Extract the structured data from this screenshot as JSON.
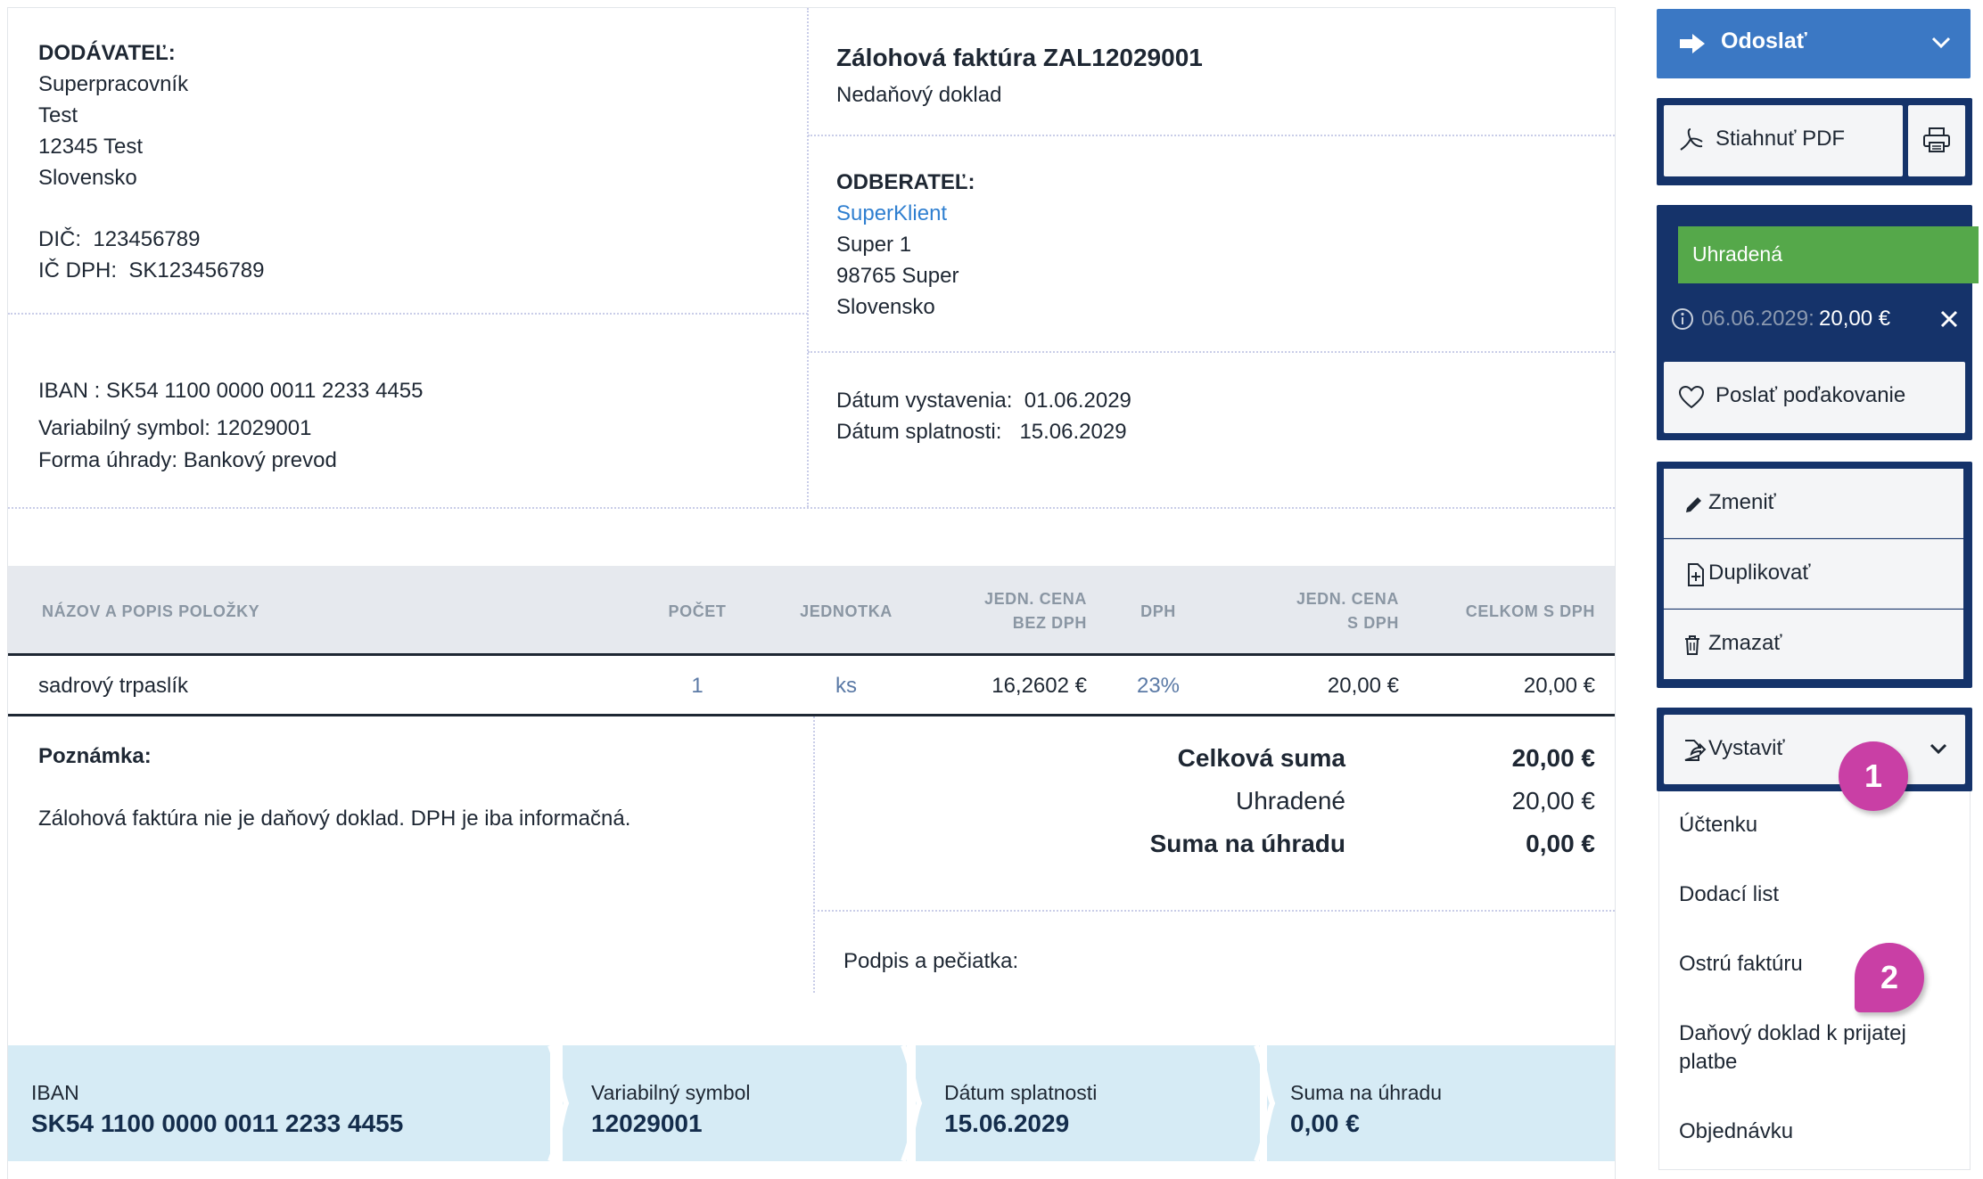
{
  "supplier": {
    "heading": "DODÁVATEĽ:",
    "name": "Superpracovník",
    "street": "Test",
    "city": "12345 Test",
    "country": "Slovensko",
    "dic_label": "DIČ:",
    "dic": "123456789",
    "icdph_label": "IČ DPH:",
    "icdph": "SK123456789"
  },
  "payment_info": {
    "iban_line": "IBAN : SK54 1100 0000 0011 2233 4455",
    "vs_line": "Variabilný symbol: 12029001",
    "method_line": "Forma úhrady: Bankový prevod"
  },
  "document": {
    "title": "Zálohová faktúra ZAL12029001",
    "subtitle": "Nedaňový doklad"
  },
  "customer": {
    "heading": "ODBERATEĽ:",
    "name": "SuperKlient",
    "street": "Super 1",
    "city": "98765 Super",
    "country": "Slovensko"
  },
  "dates": {
    "issue_label": "Dátum vystavenia:",
    "issue": "01.06.2029",
    "due_label": "Dátum splatnosti:",
    "due": "15.06.2029"
  },
  "table": {
    "headers": {
      "name": "NÁZOV A POPIS POLOŽKY",
      "qty": "POČET",
      "unit": "JEDNOTKA",
      "price_no_vat_1": "JEDN. CENA",
      "price_no_vat_2": "BEZ DPH",
      "vat": "DPH",
      "price_vat_1": "JEDN. CENA",
      "price_vat_2": "S DPH",
      "total": "CELKOM S DPH"
    },
    "rows": [
      {
        "name": "sadrový trpaslík",
        "qty": "1",
        "unit": "ks",
        "price_no_vat": "16,2602 €",
        "vat": "23%",
        "price_vat": "20,00 €",
        "total": "20,00 €"
      }
    ]
  },
  "note": {
    "heading": "Poznámka:",
    "text": "Zálohová faktúra nie je daňový doklad. DPH je iba informačná."
  },
  "totals": {
    "total_label": "Celková suma",
    "total": "20,00 €",
    "paid_label": "Uhradené",
    "paid": "20,00 €",
    "due_label": "Suma na úhradu",
    "due": "0,00 €"
  },
  "signature_label": "Podpis a pečiatka:",
  "strip": {
    "iban_label": "IBAN",
    "iban": "SK54 1100 0000 0011 2233 4455",
    "vs_label": "Variabilný symbol",
    "vs": "12029001",
    "due_label": "Dátum splatnosti",
    "due": "15.06.2029",
    "amount_label": "Suma na úhradu",
    "amount": "0,00 €"
  },
  "sidebar": {
    "send": "Odoslať",
    "download_pdf": "Stiahnuť PDF",
    "status": "Uhradená",
    "payment_date": "06.06.2029:",
    "payment_amount": "20,00 €",
    "thank": "Poslať poďakovanie",
    "edit": "Zmeniť",
    "duplicate": "Duplikovať",
    "delete": "Zmazať",
    "issue": "Vystaviť",
    "issue_options": [
      "Účtenku",
      "Dodací list",
      "Ostrú faktúru",
      "Daňový doklad k prijatej platbe",
      "Objednávku"
    ]
  },
  "annotations": {
    "badge_1": "1",
    "badge_2": "2"
  },
  "colors": {
    "send_button": "#3b78c4",
    "panel_navy": "#15336a",
    "status_green": "#55a84a",
    "strip_blue": "#d6ebf5",
    "badge_magenta": "#c93fa5",
    "link_blue": "#2f7fd0"
  }
}
